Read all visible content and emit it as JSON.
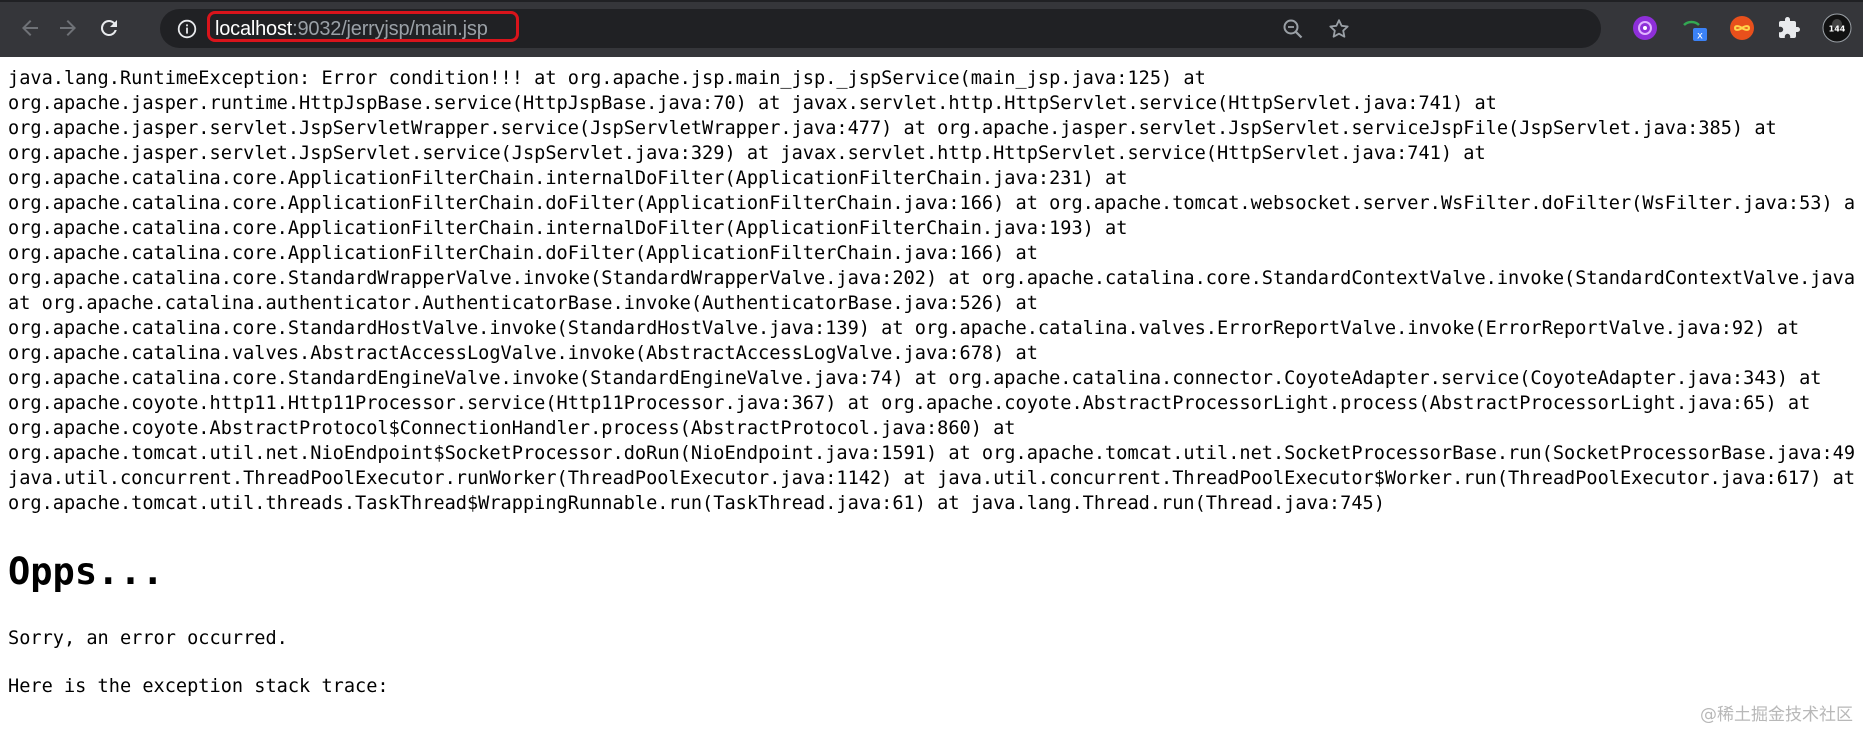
{
  "browser": {
    "url_host": "localhost",
    "url_rest": ":9032/jerryjsp/main.jsp",
    "profile_badge": "144",
    "extension_badge": "x",
    "accent_highlight": "#d9141b"
  },
  "page": {
    "stack_trace_lines": [
      "java.lang.RuntimeException: Error condition!!! at org.apache.jsp.main_jsp._jspService(main_jsp.java:125) at",
      "org.apache.jasper.runtime.HttpJspBase.service(HttpJspBase.java:70) at javax.servlet.http.HttpServlet.service(HttpServlet.java:741) at",
      "org.apache.jasper.servlet.JspServletWrapper.service(JspServletWrapper.java:477) at org.apache.jasper.servlet.JspServlet.serviceJspFile(JspServlet.java:385) at",
      "org.apache.jasper.servlet.JspServlet.service(JspServlet.java:329) at javax.servlet.http.HttpServlet.service(HttpServlet.java:741) at",
      "org.apache.catalina.core.ApplicationFilterChain.internalDoFilter(ApplicationFilterChain.java:231) at",
      "org.apache.catalina.core.ApplicationFilterChain.doFilter(ApplicationFilterChain.java:166) at org.apache.tomcat.websocket.server.WsFilter.doFilter(WsFilter.java:53) a",
      "org.apache.catalina.core.ApplicationFilterChain.internalDoFilter(ApplicationFilterChain.java:193) at",
      "org.apache.catalina.core.ApplicationFilterChain.doFilter(ApplicationFilterChain.java:166) at",
      "org.apache.catalina.core.StandardWrapperValve.invoke(StandardWrapperValve.java:202) at org.apache.catalina.core.StandardContextValve.invoke(StandardContextValve.java",
      "at org.apache.catalina.authenticator.AuthenticatorBase.invoke(AuthenticatorBase.java:526) at",
      "org.apache.catalina.core.StandardHostValve.invoke(StandardHostValve.java:139) at org.apache.catalina.valves.ErrorReportValve.invoke(ErrorReportValve.java:92) at",
      "org.apache.catalina.valves.AbstractAccessLogValve.invoke(AbstractAccessLogValve.java:678) at",
      "org.apache.catalina.core.StandardEngineValve.invoke(StandardEngineValve.java:74) at org.apache.catalina.connector.CoyoteAdapter.service(CoyoteAdapter.java:343) at",
      "org.apache.coyote.http11.Http11Processor.service(Http11Processor.java:367) at org.apache.coyote.AbstractProcessorLight.process(AbstractProcessorLight.java:65) at",
      "org.apache.coyote.AbstractProtocol$ConnectionHandler.process(AbstractProtocol.java:860) at",
      "org.apache.tomcat.util.net.NioEndpoint$SocketProcessor.doRun(NioEndpoint.java:1591) at org.apache.tomcat.util.net.SocketProcessorBase.run(SocketProcessorBase.java:49",
      "java.util.concurrent.ThreadPoolExecutor.runWorker(ThreadPoolExecutor.java:1142) at java.util.concurrent.ThreadPoolExecutor$Worker.run(ThreadPoolExecutor.java:617) at",
      "org.apache.tomcat.util.threads.TaskThread$WrappingRunnable.run(TaskThread.java:61) at java.lang.Thread.run(Thread.java:745)"
    ],
    "heading": "Opps...",
    "message": "Sorry, an error occurred.",
    "trace_intro": "Here is the exception stack trace:"
  },
  "watermark": "@稀土掘金技术社区"
}
